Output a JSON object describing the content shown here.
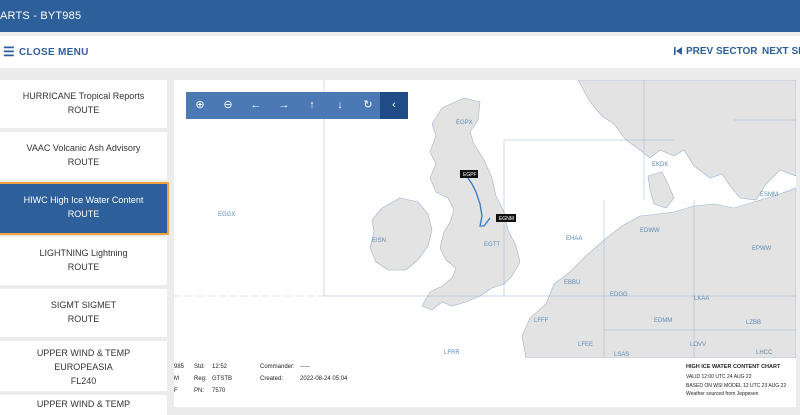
{
  "header": {
    "title": "ARTS - BYT985"
  },
  "toolbar": {
    "close_icon": "menu-icon",
    "close_label": "CLOSE MENU",
    "prev_icon": "skip-back-icon",
    "prev_label": "PREV SECTOR",
    "next_label": "NEXT SEC"
  },
  "sidebar": {
    "items": [
      {
        "title": "HURRICANE Tropical Reports",
        "sub": "ROUTE"
      },
      {
        "title": "VAAC Volcanic Ash Advisory",
        "sub": "ROUTE"
      },
      {
        "title": "HIWC High Ice Water Content",
        "sub": "ROUTE"
      },
      {
        "title": "LIGHTNING Lightning",
        "sub": "ROUTE"
      },
      {
        "title": "SIGMT SIGMET",
        "sub": "ROUTE"
      },
      {
        "title": "UPPER WIND & TEMP",
        "sub": "EUROPEASIA",
        "sub2": "FL240"
      },
      {
        "title": "UPPER WIND & TEMP"
      }
    ]
  },
  "map": {
    "tools": [
      "zoom-in-icon",
      "zoom-out-icon",
      "arrow-left-icon",
      "arrow-right-icon",
      "arrow-up-icon",
      "arrow-down-icon",
      "refresh-icon",
      "collapse-icon"
    ],
    "regions": [
      "EGPX",
      "EGGX",
      "EISN",
      "EGTT",
      "EKDK",
      "EHAA",
      "EDWW",
      "EBBU",
      "EDGG",
      "EPWW",
      "LKAA",
      "LFFF",
      "EDMM",
      "LZBB",
      "LFEE",
      "LSAS",
      "LOVV",
      "LHCC",
      "LFRR",
      "ESMM"
    ],
    "markers": [
      "EGPF",
      "EGNM"
    ],
    "colors": {
      "route": "#3777c4",
      "land": "#e3e3e3",
      "sea": "#ffffff",
      "border": "#9ab4cf"
    }
  },
  "footer": {
    "c1": [
      "985",
      "M",
      "F"
    ],
    "std_label": "Std:",
    "std_value": "12:52",
    "reg_label": "Reg:",
    "reg_value": "GTSTB",
    "pn_label": "PN:",
    "pn_value": "7570",
    "commander_label": "Commander:",
    "commander_value": "-----",
    "created_label": "Created:",
    "created_value": "2022-08-24 05:04",
    "chart_lines": [
      "HIGH ICE WATER CONTENT CHART",
      "VALID 12:00 UTC 24 AUG 22",
      "BASED ON WSI MODEL 12 UTC 23 AUG 22",
      "Weather sourced from Jeppesen"
    ]
  }
}
